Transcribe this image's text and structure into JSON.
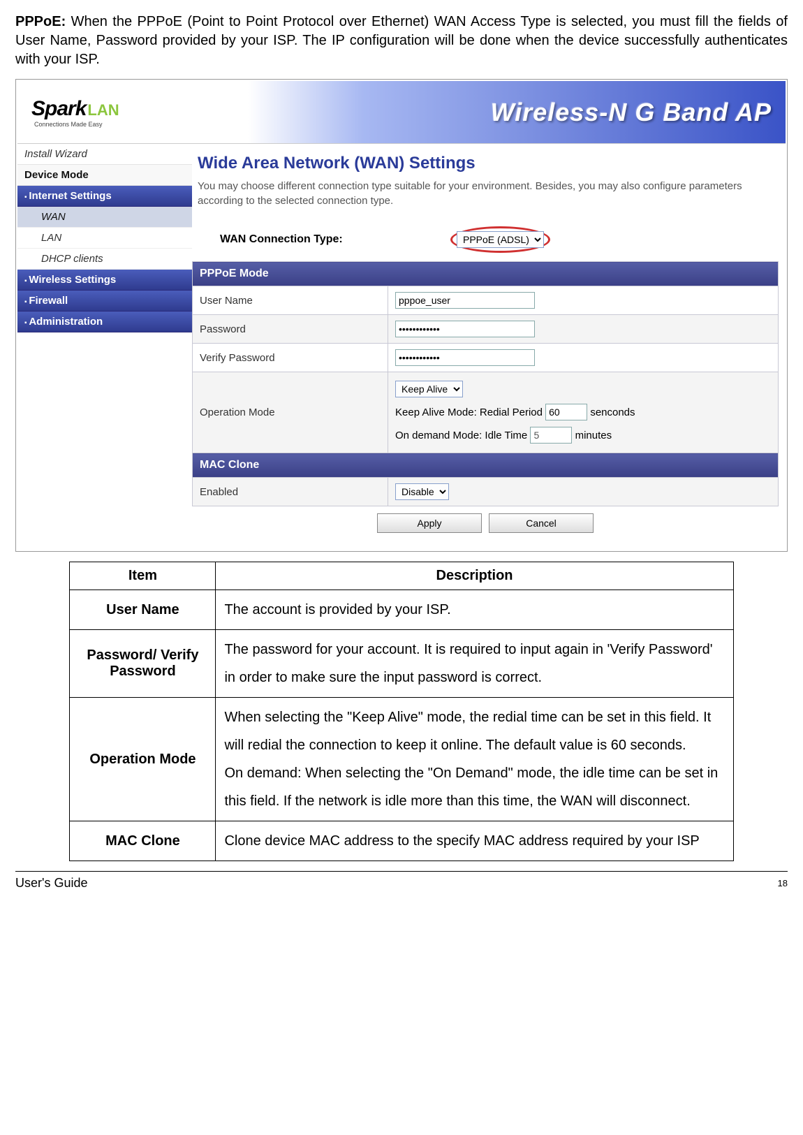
{
  "intro": {
    "prefix": "PPPoE:",
    "body": "When the PPPoE (Point to Point Protocol over Ethernet) WAN Access Type is selected, you must fill the fields of User Name, Password provided by your ISP. The IP configuration will be done when the device successfully authenticates with your ISP."
  },
  "logo": {
    "spark": "Spark",
    "lan": "LAN",
    "tagline": "Connections Made Easy"
  },
  "banner_title": "Wireless-N G Band AP",
  "nav": {
    "install": "Install Wizard",
    "device_mode": "Device Mode",
    "internet": "Internet Settings",
    "wan": "WAN",
    "lan": "LAN",
    "dhcp": "DHCP clients",
    "wireless": "Wireless Settings",
    "firewall": "Firewall",
    "admin": "Administration"
  },
  "main": {
    "title": "Wide Area Network (WAN) Settings",
    "desc": "You may choose different connection type suitable for your environment. Besides, you may also configure parameters according to the selected connection type."
  },
  "wan": {
    "label": "WAN Connection Type:",
    "select_value": "PPPoE (ADSL)"
  },
  "pppoe": {
    "section": "PPPoE Mode",
    "user_label": "User Name",
    "user_value": "pppoe_user",
    "pass_label": "Password",
    "pass_value": "••••••••••••",
    "vpass_label": "Verify Password",
    "vpass_value": "••••••••••••",
    "op_label": "Operation Mode",
    "op_select": "Keep Alive",
    "op_keep_prefix": "Keep Alive Mode: Redial Period",
    "op_keep_value": "60",
    "op_keep_suffix": "senconds",
    "op_ondemand_prefix": "On demand Mode: Idle Time",
    "op_ondemand_value": "5",
    "op_ondemand_suffix": "minutes"
  },
  "macclone": {
    "section": "MAC Clone",
    "enabled_label": "Enabled",
    "enabled_value": "Disable"
  },
  "buttons": {
    "apply": "Apply",
    "cancel": "Cancel"
  },
  "desc_table": {
    "h_item": "Item",
    "h_desc": "Description",
    "rows": [
      {
        "item": "User Name",
        "desc": "The account is provided by your ISP."
      },
      {
        "item": "Password/ Verify Password",
        "desc": "The password for your account. It is required to input again in 'Verify Password' in order to make sure the input password is correct."
      },
      {
        "item": "Operation Mode",
        "desc": "When selecting the \"Keep Alive\" mode, the redial time can be set in this field. It will redial the connection to keep it online. The default value is 60 seconds.\nOn demand: When selecting the \"On Demand\" mode, the idle time can be set in this field. If the network is idle more than this time, the WAN will disconnect."
      },
      {
        "item": "MAC Clone",
        "desc": "Clone device MAC address to the specify MAC address required by your ISP"
      }
    ]
  },
  "footer": {
    "left": "User's Guide",
    "page": "18"
  }
}
